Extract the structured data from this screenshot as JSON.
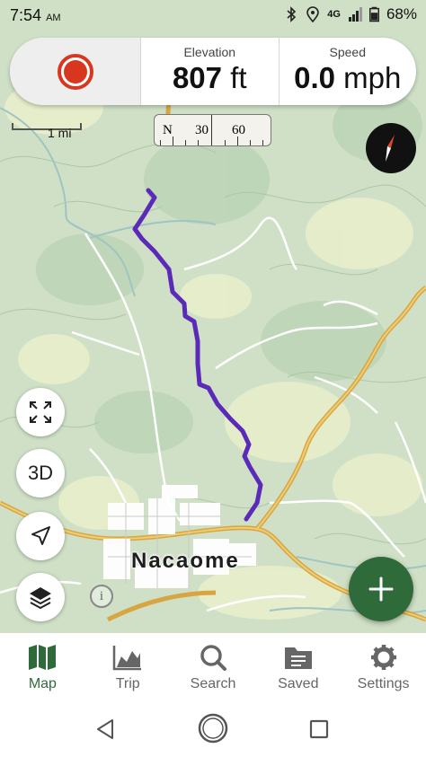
{
  "status_bar": {
    "time": "7:54",
    "ampm": "AM",
    "network": "4G",
    "battery": "68%",
    "icons": [
      "bluetooth-icon",
      "location-icon",
      "signal-icon",
      "battery-icon"
    ]
  },
  "stats": {
    "record_icon": "record-icon",
    "elevation_label": "Elevation",
    "elevation_value": "807",
    "elevation_unit": "ft",
    "speed_label": "Speed",
    "speed_value": "0.0",
    "speed_unit": "mph"
  },
  "scale": {
    "label": "1 mi"
  },
  "heading": {
    "north_label": "N",
    "label_30": "30",
    "label_60": "60"
  },
  "map": {
    "town_name": "Nacaome",
    "info_symbol": "i",
    "colors": {
      "track": "#5b2ab8",
      "highway": "#e8b53a",
      "water": "#9fc4c4",
      "terrain": "#c7dcc0",
      "clearing": "#e6edc8"
    }
  },
  "map_controls": {
    "fullscreen_icon": "expand-icon",
    "three_d_label": "3D",
    "locate_icon": "navigation-arrow-icon",
    "layers_icon": "layers-icon",
    "add_icon": "plus-icon"
  },
  "bottom_nav": {
    "items": [
      {
        "label": "Map",
        "icon": "map-icon",
        "active": true
      },
      {
        "label": "Trip",
        "icon": "chart-icon",
        "active": false
      },
      {
        "label": "Search",
        "icon": "search-icon",
        "active": false
      },
      {
        "label": "Saved",
        "icon": "folder-icon",
        "active": false
      },
      {
        "label": "Settings",
        "icon": "gear-icon",
        "active": false
      }
    ]
  },
  "system_nav": {
    "icons": [
      "back-icon",
      "home-icon",
      "recents-icon"
    ]
  },
  "theme": {
    "accent": "#2f6b3a",
    "record": "#d8361f"
  }
}
